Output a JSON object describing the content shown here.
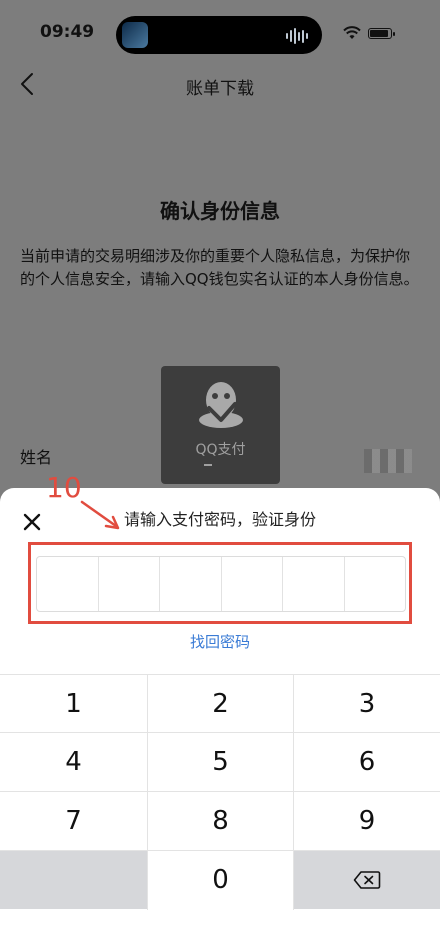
{
  "status_bar": {
    "time": "09:49"
  },
  "nav": {
    "title": "账单下载"
  },
  "page": {
    "heading": "确认身份信息",
    "description": "当前申请的交易明细涉及你的重要个人隐私信息，为保护你的个人信息安全，请输入QQ钱包实名认证的本人身份信息。",
    "name_label": "姓名"
  },
  "qq_pay_overlay": {
    "label": "QQ支付",
    "dash": "-"
  },
  "sheet": {
    "title": "请输入支付密码，验证身份",
    "forgot_password": "找回密码",
    "pin_length": 6,
    "annotation_number": "10",
    "annotation_color": "#e14c3f"
  },
  "keypad": {
    "keys": [
      "1",
      "2",
      "3",
      "4",
      "5",
      "6",
      "7",
      "8",
      "9",
      "0"
    ]
  },
  "colors": {
    "link": "#3a7bd5",
    "dim_overlay": "#7d7d7d"
  }
}
